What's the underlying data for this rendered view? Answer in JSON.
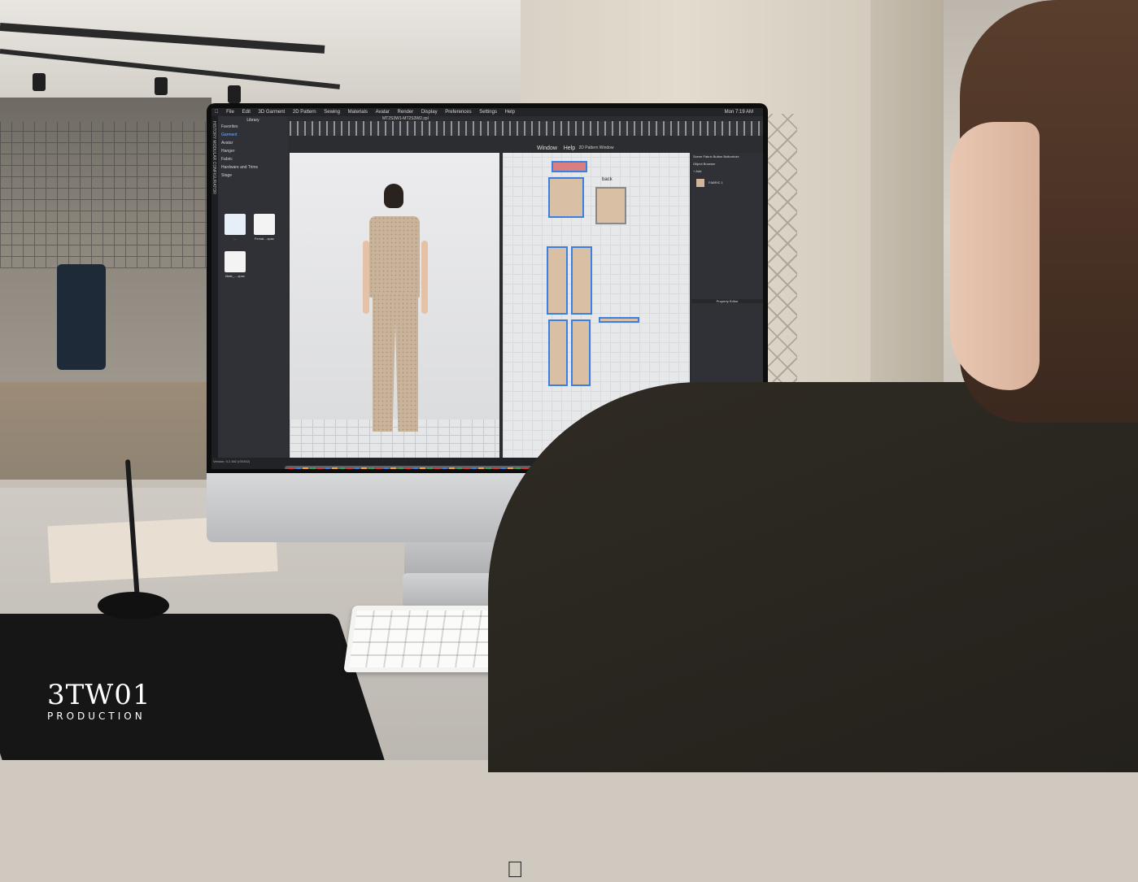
{
  "screen": {
    "menu_items": [
      "File",
      "Edit",
      "3D Garment",
      "2D Pattern",
      "Sewing",
      "Materials",
      "Avatar",
      "Render",
      "Display",
      "Preferences",
      "Settings",
      "Help"
    ],
    "clock": "Mon 7:19 AM",
    "window_menu": "Window",
    "help_menu": "Help",
    "doc_title": "MT2S3W1-MT2S3W2.zpl",
    "history_label": "HISTORY  MODULAR CONFIGURATOR",
    "library": {
      "title": "Library",
      "items": [
        "Favorites",
        "Garment",
        "Avatar",
        "Hanger",
        "Fabric",
        "Hardware and Trims",
        "Stage"
      ],
      "selected": "Garment",
      "thumbs": [
        {
          "label": "..."
        },
        {
          "label": "Femal....zpac"
        },
        {
          "label": "Male_....zpac"
        }
      ]
    },
    "pattern_window_title": "2D Pattern Window",
    "back_label": "back",
    "right_panel": {
      "tabs": [
        "Scene",
        "Fabric",
        "Button",
        "Buttonhole"
      ],
      "object_browser": "Object Browser",
      "add_label": "+ Add",
      "fabric_name": "FABRIC 1",
      "property_editor": "Property Editor"
    },
    "version": "Version: 5.2.382 (r30352)"
  },
  "watermark": {
    "brand": "3TW01",
    "subtitle": "PRODUCTION"
  }
}
